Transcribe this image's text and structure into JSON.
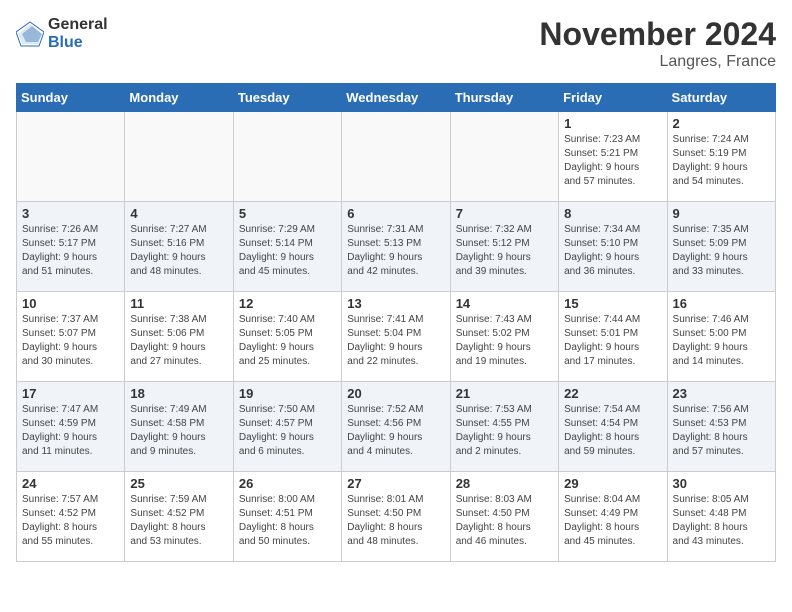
{
  "logo": {
    "general": "General",
    "blue": "Blue"
  },
  "title": "November 2024",
  "location": "Langres, France",
  "days_header": [
    "Sunday",
    "Monday",
    "Tuesday",
    "Wednesday",
    "Thursday",
    "Friday",
    "Saturday"
  ],
  "weeks": [
    [
      {
        "day": "",
        "info": "",
        "empty": true
      },
      {
        "day": "",
        "info": "",
        "empty": true
      },
      {
        "day": "",
        "info": "",
        "empty": true
      },
      {
        "day": "",
        "info": "",
        "empty": true
      },
      {
        "day": "",
        "info": "",
        "empty": true
      },
      {
        "day": "1",
        "info": "Sunrise: 7:23 AM\nSunset: 5:21 PM\nDaylight: 9 hours\nand 57 minutes."
      },
      {
        "day": "2",
        "info": "Sunrise: 7:24 AM\nSunset: 5:19 PM\nDaylight: 9 hours\nand 54 minutes."
      }
    ],
    [
      {
        "day": "3",
        "info": "Sunrise: 7:26 AM\nSunset: 5:17 PM\nDaylight: 9 hours\nand 51 minutes."
      },
      {
        "day": "4",
        "info": "Sunrise: 7:27 AM\nSunset: 5:16 PM\nDaylight: 9 hours\nand 48 minutes."
      },
      {
        "day": "5",
        "info": "Sunrise: 7:29 AM\nSunset: 5:14 PM\nDaylight: 9 hours\nand 45 minutes."
      },
      {
        "day": "6",
        "info": "Sunrise: 7:31 AM\nSunset: 5:13 PM\nDaylight: 9 hours\nand 42 minutes."
      },
      {
        "day": "7",
        "info": "Sunrise: 7:32 AM\nSunset: 5:12 PM\nDaylight: 9 hours\nand 39 minutes."
      },
      {
        "day": "8",
        "info": "Sunrise: 7:34 AM\nSunset: 5:10 PM\nDaylight: 9 hours\nand 36 minutes."
      },
      {
        "day": "9",
        "info": "Sunrise: 7:35 AM\nSunset: 5:09 PM\nDaylight: 9 hours\nand 33 minutes."
      }
    ],
    [
      {
        "day": "10",
        "info": "Sunrise: 7:37 AM\nSunset: 5:07 PM\nDaylight: 9 hours\nand 30 minutes."
      },
      {
        "day": "11",
        "info": "Sunrise: 7:38 AM\nSunset: 5:06 PM\nDaylight: 9 hours\nand 27 minutes."
      },
      {
        "day": "12",
        "info": "Sunrise: 7:40 AM\nSunset: 5:05 PM\nDaylight: 9 hours\nand 25 minutes."
      },
      {
        "day": "13",
        "info": "Sunrise: 7:41 AM\nSunset: 5:04 PM\nDaylight: 9 hours\nand 22 minutes."
      },
      {
        "day": "14",
        "info": "Sunrise: 7:43 AM\nSunset: 5:02 PM\nDaylight: 9 hours\nand 19 minutes."
      },
      {
        "day": "15",
        "info": "Sunrise: 7:44 AM\nSunset: 5:01 PM\nDaylight: 9 hours\nand 17 minutes."
      },
      {
        "day": "16",
        "info": "Sunrise: 7:46 AM\nSunset: 5:00 PM\nDaylight: 9 hours\nand 14 minutes."
      }
    ],
    [
      {
        "day": "17",
        "info": "Sunrise: 7:47 AM\nSunset: 4:59 PM\nDaylight: 9 hours\nand 11 minutes."
      },
      {
        "day": "18",
        "info": "Sunrise: 7:49 AM\nSunset: 4:58 PM\nDaylight: 9 hours\nand 9 minutes."
      },
      {
        "day": "19",
        "info": "Sunrise: 7:50 AM\nSunset: 4:57 PM\nDaylight: 9 hours\nand 6 minutes."
      },
      {
        "day": "20",
        "info": "Sunrise: 7:52 AM\nSunset: 4:56 PM\nDaylight: 9 hours\nand 4 minutes."
      },
      {
        "day": "21",
        "info": "Sunrise: 7:53 AM\nSunset: 4:55 PM\nDaylight: 9 hours\nand 2 minutes."
      },
      {
        "day": "22",
        "info": "Sunrise: 7:54 AM\nSunset: 4:54 PM\nDaylight: 8 hours\nand 59 minutes."
      },
      {
        "day": "23",
        "info": "Sunrise: 7:56 AM\nSunset: 4:53 PM\nDaylight: 8 hours\nand 57 minutes."
      }
    ],
    [
      {
        "day": "24",
        "info": "Sunrise: 7:57 AM\nSunset: 4:52 PM\nDaylight: 8 hours\nand 55 minutes."
      },
      {
        "day": "25",
        "info": "Sunrise: 7:59 AM\nSunset: 4:52 PM\nDaylight: 8 hours\nand 53 minutes."
      },
      {
        "day": "26",
        "info": "Sunrise: 8:00 AM\nSunset: 4:51 PM\nDaylight: 8 hours\nand 50 minutes."
      },
      {
        "day": "27",
        "info": "Sunrise: 8:01 AM\nSunset: 4:50 PM\nDaylight: 8 hours\nand 48 minutes."
      },
      {
        "day": "28",
        "info": "Sunrise: 8:03 AM\nSunset: 4:50 PM\nDaylight: 8 hours\nand 46 minutes."
      },
      {
        "day": "29",
        "info": "Sunrise: 8:04 AM\nSunset: 4:49 PM\nDaylight: 8 hours\nand 45 minutes."
      },
      {
        "day": "30",
        "info": "Sunrise: 8:05 AM\nSunset: 4:48 PM\nDaylight: 8 hours\nand 43 minutes."
      }
    ]
  ]
}
